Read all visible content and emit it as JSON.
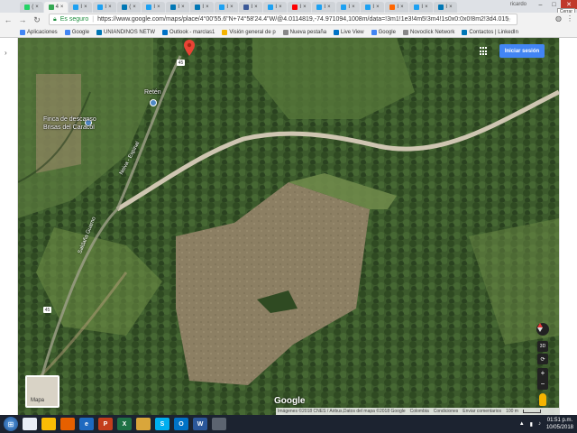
{
  "browser": {
    "tabs": [
      {
        "label": "(",
        "color": "#25d366"
      },
      {
        "label": "4",
        "color": "#34a853"
      },
      {
        "label": "I",
        "color": "#1da1f2"
      },
      {
        "label": "I",
        "color": "#1da1f2"
      },
      {
        "label": "(",
        "color": "#0077b5"
      },
      {
        "label": "I",
        "color": "#1da1f2"
      },
      {
        "label": "I",
        "color": "#0077b5"
      },
      {
        "label": "I",
        "color": "#0077b5"
      },
      {
        "label": "I",
        "color": "#1da1f2"
      },
      {
        "label": "I",
        "color": "#3b5998"
      },
      {
        "label": "I",
        "color": "#1da1f2"
      },
      {
        "label": "I",
        "color": "#ff0000"
      },
      {
        "label": "I",
        "color": "#1da1f2"
      },
      {
        "label": "I",
        "color": "#1da1f2"
      },
      {
        "label": "I",
        "color": "#1da1f2"
      },
      {
        "label": "I",
        "color": "#ff6600"
      },
      {
        "label": "I",
        "color": "#1da1f2"
      },
      {
        "label": "I",
        "color": "#0077b5"
      }
    ],
    "profile": "ricardo",
    "close_tooltip": "Cerrar",
    "secure_label": "Es seguro",
    "url": "https://www.google.com/maps/place/4°00'55.6\"N+74°58'24.4\"W/@4.0114819,-74.971094,1008m/data=!3m1!1e3!4m5!3m4!1s0x0:0x0!8m2!3d4.015",
    "bookmarks": [
      {
        "label": "Aplicaciones",
        "color": "#4285f4"
      },
      {
        "label": "Google",
        "color": "#4285f4"
      },
      {
        "label": "UNIANDINOS NETW",
        "color": "#0077b5"
      },
      {
        "label": "Outlook - marclas1",
        "color": "#0072c6"
      },
      {
        "label": "Visión general de p",
        "color": "#f4b400"
      },
      {
        "label": "Nueva pestaña",
        "color": "#888888"
      },
      {
        "label": "Live View",
        "color": "#0072c6"
      },
      {
        "label": "Google",
        "color": "#4285f4"
      },
      {
        "label": "Novoclick Network",
        "color": "#888888"
      },
      {
        "label": "Contactos | LinkedIn",
        "color": "#0077b5"
      }
    ]
  },
  "map": {
    "sign_in": "Iniciar sesión",
    "places": {
      "finca_line1": "Finca de descanso",
      "finca_line2": "Brisas del Caracol",
      "reten": "Retén"
    },
    "roads": {
      "road1": "Neiva - Espinal",
      "road2": "Saldaña Guamo"
    },
    "shield": "45",
    "controls": {
      "view3d": "3D",
      "zoom_in": "+",
      "zoom_out": "−"
    },
    "minimap_label": "Mapa",
    "google_logo": "Google",
    "attribution": {
      "imagery": "Imágenes ©2018 CNES / Airbus,Datos del mapa ©2018 Google",
      "country": "Colombia",
      "terms": "Condiciones",
      "feedback": "Enviar comentarios",
      "scale": "100 m"
    }
  },
  "taskbar": {
    "apps": [
      {
        "label": "",
        "color": "#e8eef7"
      },
      {
        "label": "",
        "color": "#fbbc05"
      },
      {
        "label": "",
        "color": "#e66000"
      },
      {
        "label": "e",
        "color": "#1e6ac0"
      },
      {
        "label": "P",
        "color": "#c43e1c"
      },
      {
        "label": "X",
        "color": "#1e7145"
      },
      {
        "label": "",
        "color": "#d9a63b"
      },
      {
        "label": "S",
        "color": "#00aff0"
      },
      {
        "label": "O",
        "color": "#0072c6"
      },
      {
        "label": "W",
        "color": "#2b579a"
      },
      {
        "label": "",
        "color": "#5c6470"
      }
    ],
    "time": "01:51 p.m.",
    "date": "10/05/2018"
  }
}
